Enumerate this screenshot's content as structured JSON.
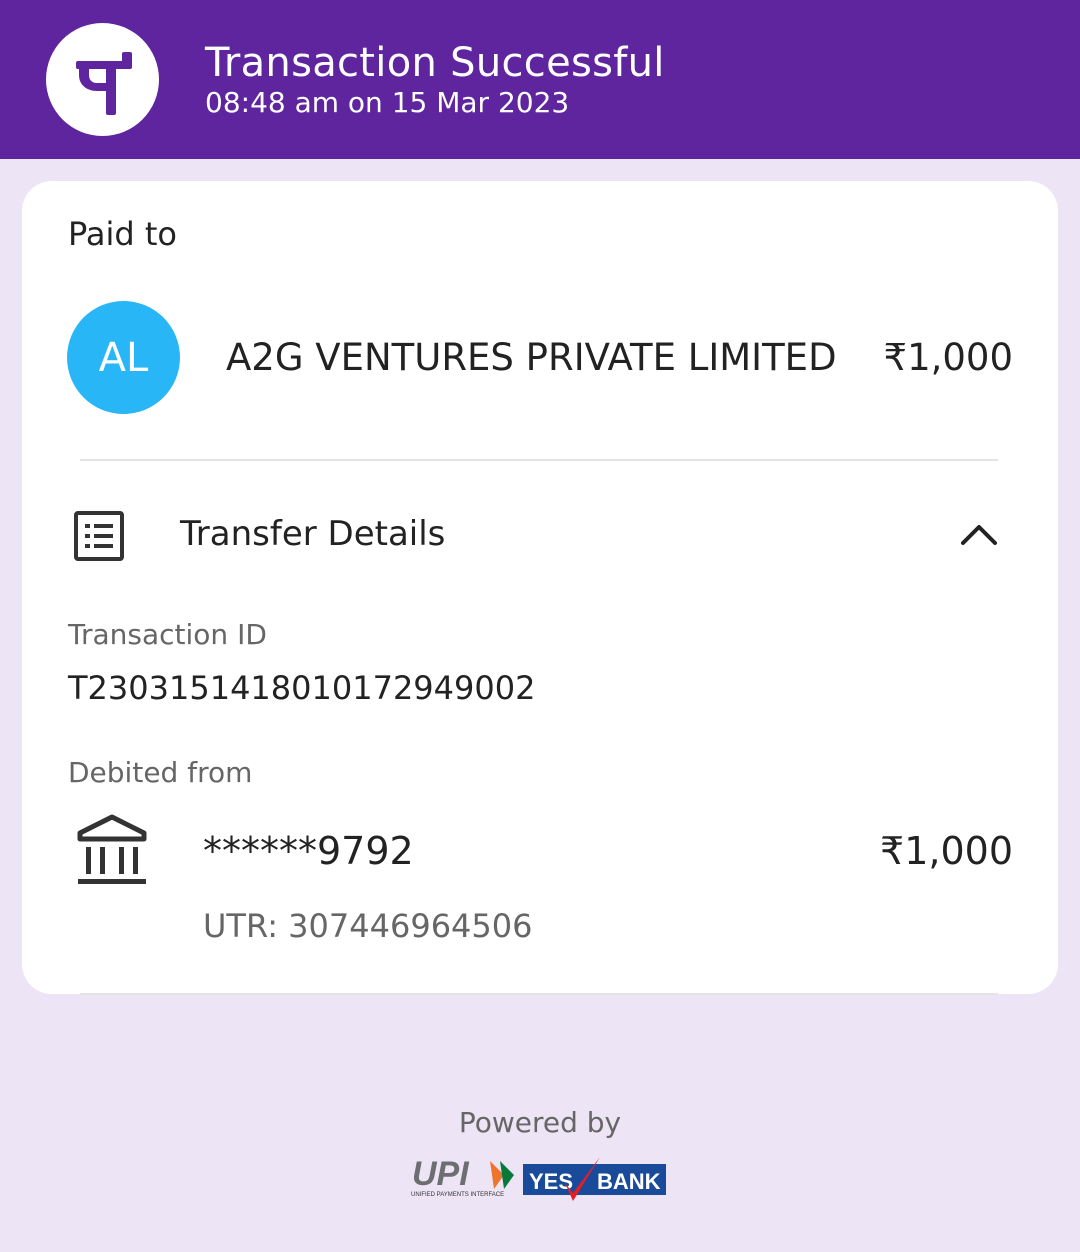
{
  "header": {
    "logo_icon": "phonepe-logo-icon",
    "title": "Transaction Successful",
    "timestamp": "08:48 am on 15 Mar 2023",
    "bg_color": "#5f259f"
  },
  "payment": {
    "paid_to_label": "Paid to",
    "avatar_initials": "AL",
    "avatar_color": "#29b6f6",
    "payee_name": "A2G VENTURES PRIVATE LIMITED",
    "amount": "₹1,000"
  },
  "transfer_details": {
    "title": "Transfer Details",
    "icon": "list-icon",
    "toggle_icon": "chevron-up-icon",
    "transaction_id_label": "Transaction ID",
    "transaction_id": "T2303151418010172949002",
    "debited_from_label": "Debited from",
    "bank_icon": "bank-icon",
    "account_masked": "******9792",
    "debit_amount": "₹1,000",
    "utr": "UTR: 307446964506"
  },
  "footer": {
    "powered_by": "Powered by",
    "upi_logo_text": "UPI",
    "upi_tagline": "UNIFIED PAYMENTS INTERFACE",
    "bank_logo_yes": "YES",
    "bank_logo_bank": "BANK"
  }
}
